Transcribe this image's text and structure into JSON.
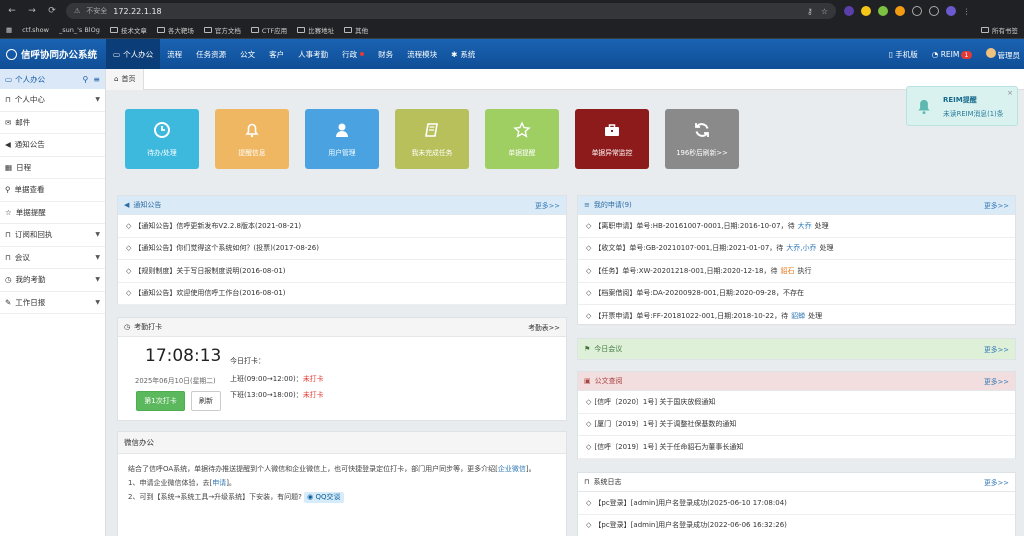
{
  "browser": {
    "security": "不安全",
    "url": "172.22.1.18",
    "bookmarks": [
      "ctf.show",
      "_sun_'s BlOg",
      "技术文章",
      "各大靶场",
      "官方文档",
      "CTF应用",
      "比赛地址",
      "其他"
    ],
    "bookmarks_right": "所有书签"
  },
  "header": {
    "title": "信呼协同办公系统",
    "nav": [
      "个人办公",
      "流程",
      "任务资源",
      "公文",
      "客户",
      "人事考勤",
      "行政",
      "财务",
      "流程模块",
      "系统"
    ],
    "mobile": "手机版",
    "reim": "REIM",
    "reim_badge": "1",
    "user": "管理员"
  },
  "sidebar": {
    "head": "个人办公",
    "items": [
      "个人中心",
      "邮件",
      "通知公告",
      "日程",
      "单据查看",
      "单据提醒",
      "订阅和回执",
      "会议",
      "我的考勤",
      "工作日报"
    ]
  },
  "tabs": {
    "home": "首页"
  },
  "tiles": [
    {
      "label": "待办/处理",
      "color": "#3cb9dc",
      "icon": "clock-icon"
    },
    {
      "label": "提醒信息",
      "color": "#f0b763",
      "icon": "bell-icon"
    },
    {
      "label": "用户管理",
      "color": "#4aa3e0",
      "icon": "user-icon"
    },
    {
      "label": "我未完成任务",
      "color": "#b7c05a",
      "icon": "book-icon"
    },
    {
      "label": "单据提醒",
      "color": "#9fce63",
      "icon": "star-icon"
    },
    {
      "label": "单据异常监控",
      "color": "#8e1b1b",
      "icon": "briefcase-icon"
    },
    {
      "label": "196秒后刷新>>",
      "color": "#8a8a8a",
      "icon": "refresh-icon"
    }
  ],
  "notice": {
    "title": "通知公告",
    "more": "更多>>",
    "items": [
      "【通知公告】信呼更新发布V2.2.8版本(2021-08-21)",
      "【通知公告】你们觉得这个系统如何？(投票)(2017-08-26)",
      "【规则制度】关于写日报制度说明(2016-08-01)",
      "【通知公告】欢迎使用信呼工作台(2016-08-01)"
    ]
  },
  "apply": {
    "title": "我的申请(9)",
    "more": "更多>>",
    "items": [
      {
        "pre": "【离职申请】单号:HB-20161007-0001,日期:2016-10-07，待",
        "who": "大乔",
        "cls": "b",
        "post": "处理"
      },
      {
        "pre": "【收文单】单号:GB-20210107-001,日期:2021-01-07，待",
        "who": "大乔,小乔",
        "cls": "b",
        "post": "处理"
      },
      {
        "pre": "【任务】单号:XW-20201218-001,日期:2020-12-18，待",
        "who": "貂石",
        "cls": "o",
        "post": "执行"
      },
      {
        "pre": "【档案借阅】单号:DA-20200928-001,日期:2020-09-28，不存在",
        "who": "",
        "cls": "b",
        "post": ""
      },
      {
        "pre": "【开票申请】单号:FF-20181022-001,日期:2018-10-22，待",
        "who": "貂蝉",
        "cls": "b",
        "post": "处理"
      }
    ]
  },
  "meeting": {
    "title": "今日会议",
    "more": "更多>>"
  },
  "docs": {
    "title": "公文查阅",
    "more": "更多>>",
    "items": [
      "[信呼〔2020〕1号] 关于国庆放假通知",
      "[厦门〔2019〕1号] 关于调整社保基数的通知",
      "[信呼〔2019〕1号] 关于任命貂石为董事长通知"
    ]
  },
  "syslog": {
    "title": "系统日志",
    "more": "更多>>",
    "items": [
      "【pc登录】[admin]用户名登录成功(2025-06-10 17:08:04)",
      "【pc登录】[admin]用户名登录成功(2022-06-06 16:32:26)"
    ]
  },
  "attendance": {
    "title": "考勤打卡",
    "more": "考勤表>>",
    "time": "17:08:13",
    "date": "2025年06月10日(星期二)",
    "today": "今日打卡：",
    "am": "上班(09:00→12:00)：",
    "pm": "下班(13:00→18:00)：",
    "status": "未打卡",
    "punch": "第1次打卡",
    "refresh": "刷新"
  },
  "wechat": {
    "title": "微信办公",
    "line1": "结合了信呼OA系统，单据待办推送提醒到个人微信和企业微信上，也可快捷登录定位打卡，部门用户同步等，更多介绍[",
    "line1_link": "企业微信",
    "line1_end": "]。",
    "line2": "1、申请企业微信体验，去[",
    "line2_link": "申请",
    "line2_end": "]。",
    "line3": "2、可到【系统→系统工具→升级系统】下安装，有问题?",
    "qq": "QQ交谈"
  },
  "toast": {
    "title": "REIM提醒",
    "body": "未读REIM消息(1)条"
  }
}
